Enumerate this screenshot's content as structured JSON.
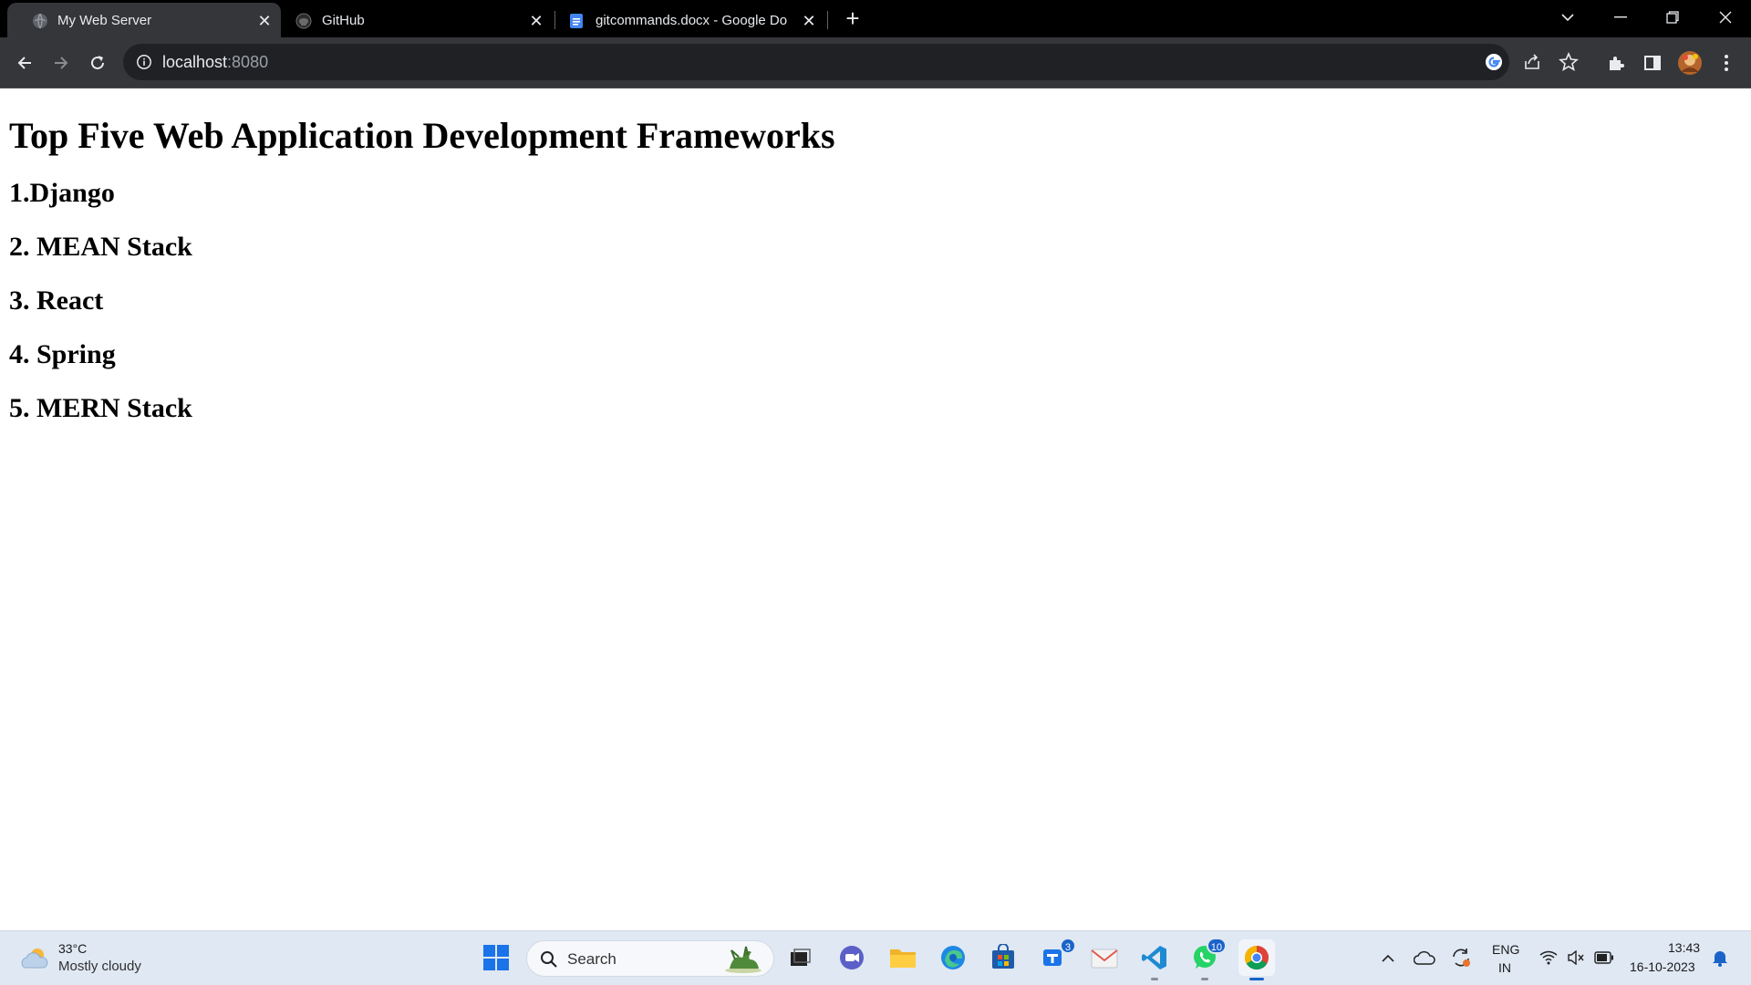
{
  "browser": {
    "tabs": [
      {
        "title": "My Web Server",
        "favicon": "globe-icon",
        "active": true
      },
      {
        "title": "GitHub",
        "favicon": "github-icon",
        "active": false
      },
      {
        "title": "gitcommands.docx - Google Do",
        "favicon": "google-docs-icon",
        "active": false
      }
    ],
    "new_tab_label": "+",
    "address": {
      "host": "localhost",
      "port": ":8080"
    }
  },
  "page": {
    "heading": "Top Five Web Application Development Frameworks",
    "items": [
      "1.Django",
      "2. MEAN Stack",
      "3. React",
      "4. Spring",
      "5. MERN Stack"
    ]
  },
  "taskbar": {
    "weather": {
      "temp": "33°C",
      "description": "Mostly cloudy"
    },
    "search_placeholder": "Search",
    "badges": {
      "teams": "3",
      "whatsapp": "10"
    },
    "language": {
      "line1": "ENG",
      "line2": "IN"
    },
    "clock": {
      "time": "13:43",
      "date": "16-10-2023"
    }
  },
  "colors": {
    "chrome_dark": "#35363a",
    "tabstrip": "#000000",
    "omnibox": "#202124",
    "taskbar": "#dfe8f3",
    "accent": "#1a63c9"
  }
}
